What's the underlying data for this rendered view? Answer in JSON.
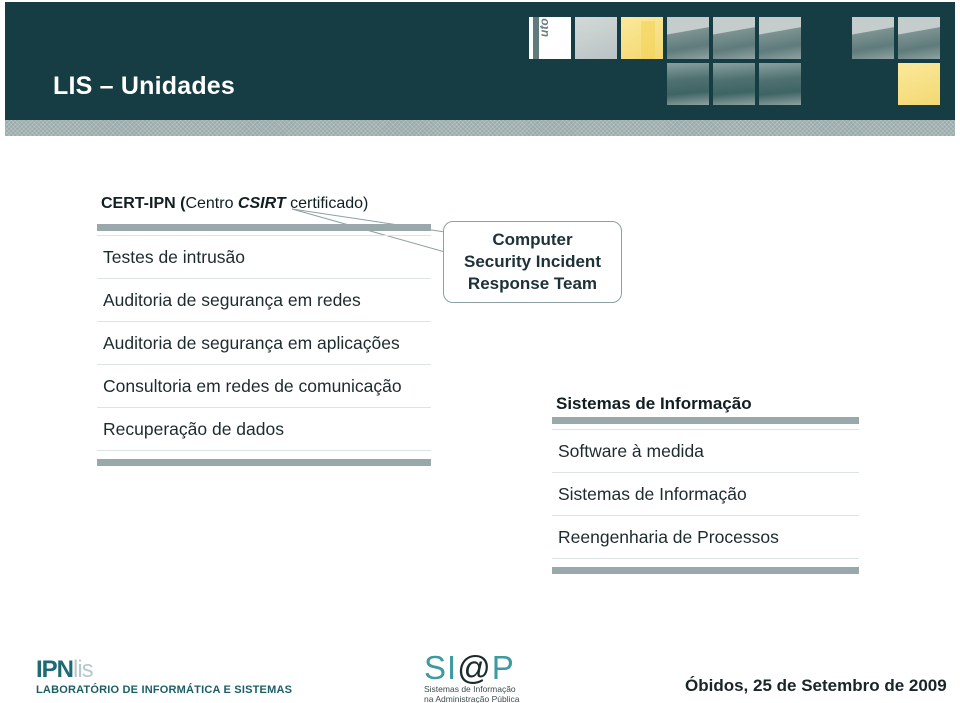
{
  "slide": {
    "title": "LIS – Unidades"
  },
  "header_images": {
    "tile_vertical_text": "uto Ped"
  },
  "left_unit": {
    "heading_bold": "CERT-IPN (",
    "heading_normal_1": "Centro ",
    "heading_italic": "CSIRT",
    "heading_normal_2": " certificado)",
    "items": [
      "Testes de intrusão",
      "Auditoria de segurança em redes",
      "Auditoria de segurança em aplicações",
      "Consultoria em redes de comunicação",
      "Recuperação de dados"
    ]
  },
  "callout": {
    "line1": "Computer",
    "line2": "Security Incident",
    "line3": "Response Team"
  },
  "right_unit": {
    "heading": "Sistemas de Informação",
    "items": [
      "Software à medida",
      "Sistemas de Informação",
      "Reengenharia de Processos"
    ]
  },
  "footer": {
    "logo_ipn": "IPN",
    "logo_lis": "lis",
    "logo_subtitle": "LABORATÓRIO DE INFORMÁTICA E SISTEMAS",
    "siap_left": "SI",
    "siap_at": "@",
    "siap_right": "P",
    "siap_sub1": "Sistemas de Informação",
    "siap_sub2": "na Administração Pública",
    "date": "Óbidos, 25 de Setembro de 2009"
  },
  "colors": {
    "header_bg": "#163c44",
    "stripe": "#9aaaaa",
    "rule": "#99a8aa",
    "accent_yellow": "#f3d873",
    "brand_teal": "#1c6b74"
  }
}
